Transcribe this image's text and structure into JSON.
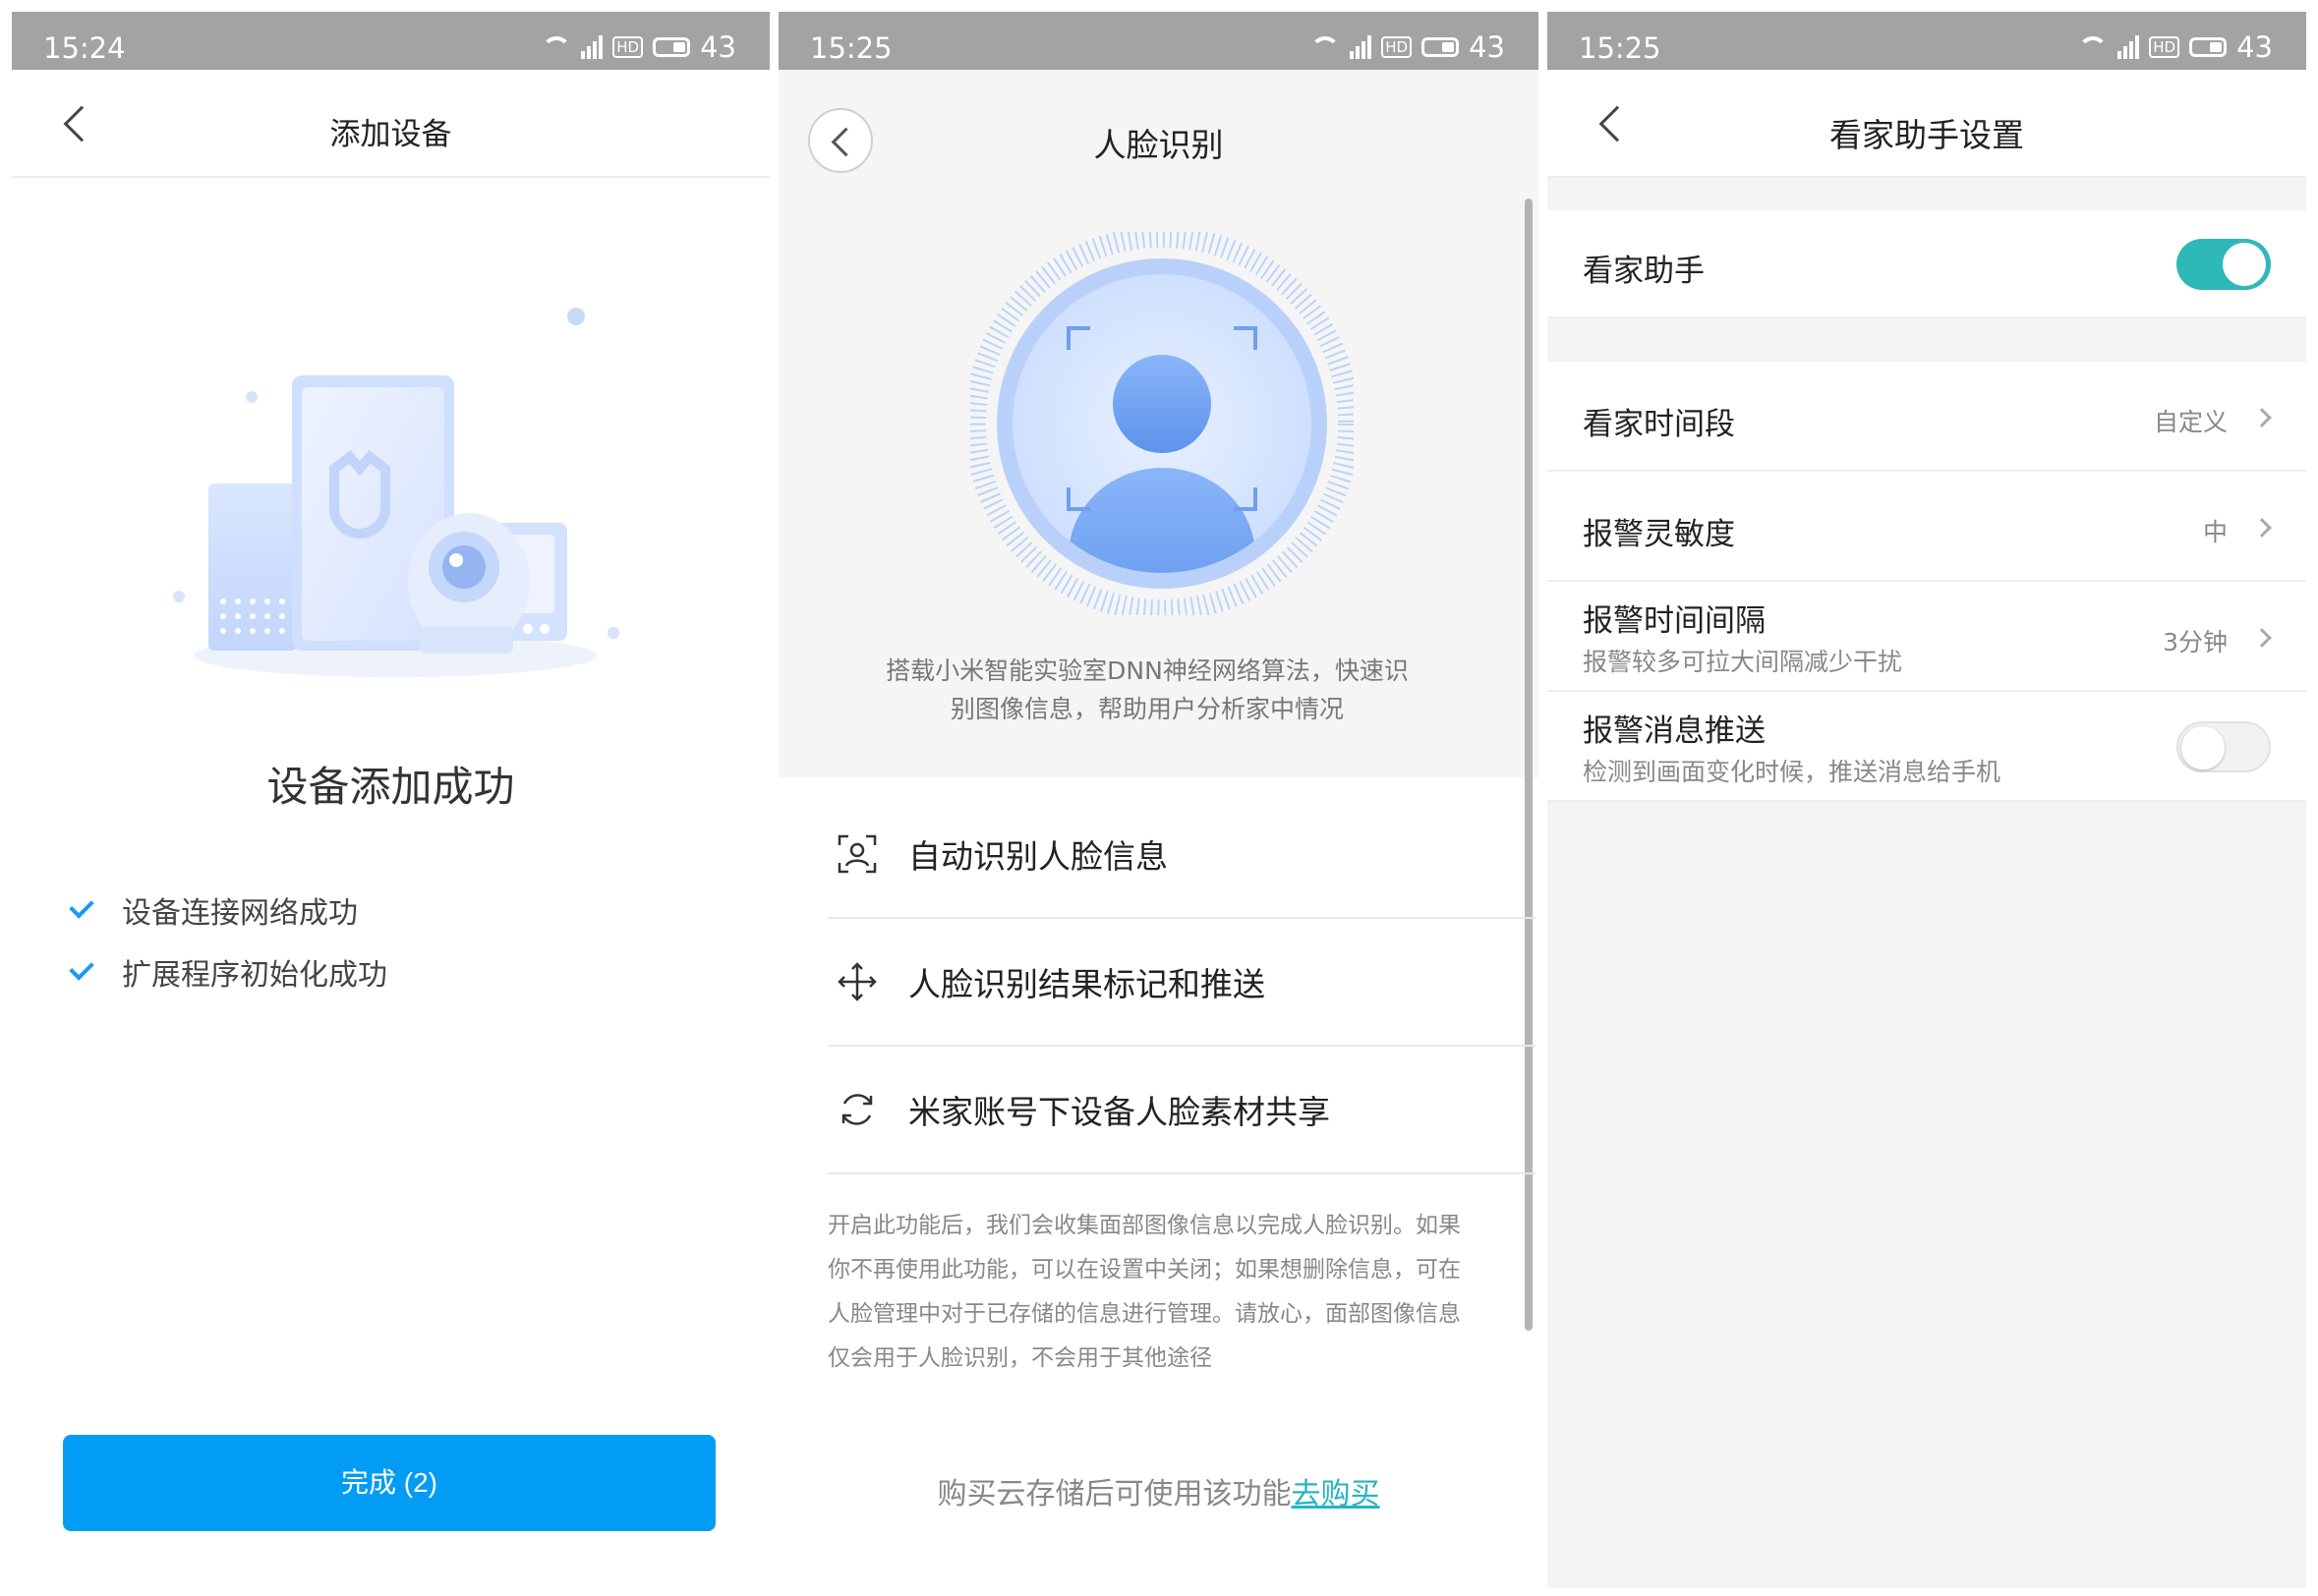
{
  "panel1": {
    "status": {
      "time": "15:24",
      "battery": "43",
      "net": "4G",
      "hd": "HD"
    },
    "header": {
      "title": "添加设备"
    },
    "success_title": "设备添加成功",
    "checks": [
      {
        "label": "设备连接网络成功"
      },
      {
        "label": "扩展程序初始化成功"
      }
    ],
    "done_button": "完成 (2)"
  },
  "panel2": {
    "status": {
      "time": "15:25",
      "battery": "43",
      "net": "4G",
      "hd": "HD"
    },
    "header": {
      "title": "人脸识别"
    },
    "description_line1": "搭载小米智能实验室DNN神经网络算法，快速识",
    "description_line2": "别图像信息，帮助用户分析家中情况",
    "features": [
      {
        "icon": "face-scan-icon",
        "label": "自动识别人脸信息"
      },
      {
        "icon": "move-arrows-icon",
        "label": "人脸识别结果标记和推送"
      },
      {
        "icon": "sync-icon",
        "label": "米家账号下设备人脸素材共享"
      }
    ],
    "notice_lines": [
      "开启此功能后，我们会收集面部图像信息以完成人脸识别。如果",
      "你不再使用此功能，可以在设置中关闭；如果想删除信息，可在",
      "人脸管理中对于已存储的信息进行管理。请放心，面部图像信息",
      "仅会用于人脸识别，不会用于其他途径"
    ],
    "buy_text": "购买云存储后可使用该功能",
    "buy_link": "去购买"
  },
  "panel3": {
    "status": {
      "time": "15:25",
      "battery": "43",
      "net": "4G",
      "hd": "HD"
    },
    "header": {
      "title": "看家助手设置"
    },
    "assistant": {
      "label": "看家助手",
      "enabled": true
    },
    "rows": [
      {
        "label": "看家时间段",
        "value": "自定义"
      },
      {
        "label": "报警灵敏度",
        "value": "中"
      },
      {
        "label": "报警时间间隔",
        "sub": "报警较多可拉大间隔减少干扰",
        "value": "3分钟"
      }
    ],
    "push": {
      "label": "报警消息推送",
      "sub": "检测到画面变化时候，推送消息给手机",
      "enabled": false
    }
  },
  "colors": {
    "primary_blue": "#039cf5",
    "teal": "#2fb8b8",
    "link": "#24b4c3",
    "statusbar": "#a3a3a3"
  }
}
